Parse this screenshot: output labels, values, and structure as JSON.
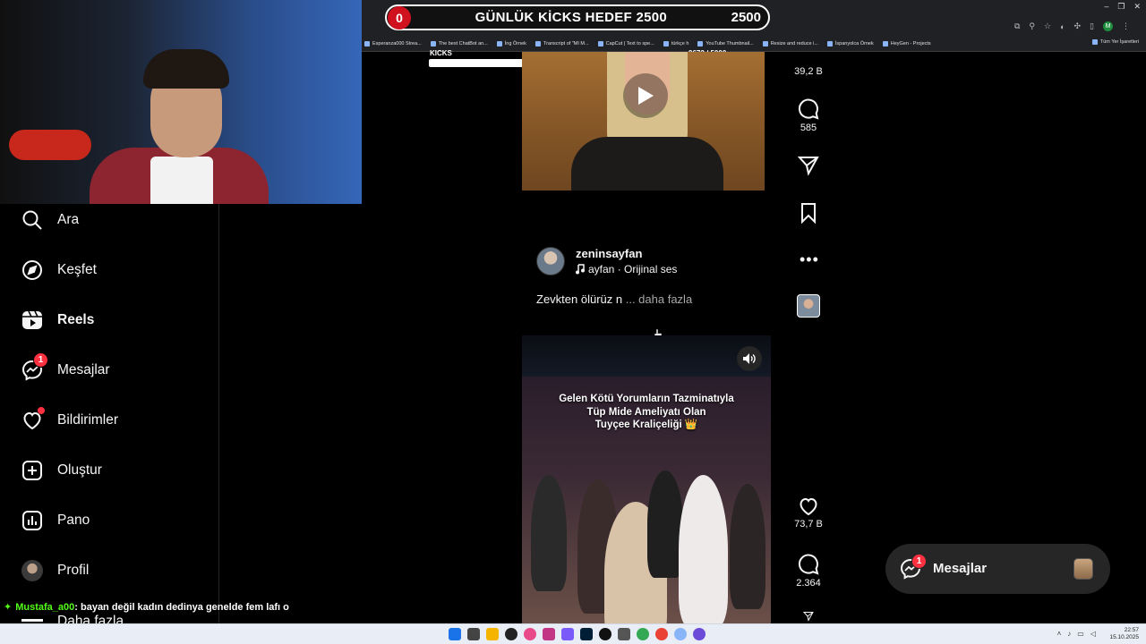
{
  "stream_overlay": {
    "goal_title": "GÜNLÜK KİCKS HEDEF 2500",
    "current_count": "0",
    "target": "2500",
    "kicks_label": "KICKS",
    "kicks_progress_text": "9672 / 5000",
    "kicks_progress_fraction": 1.0
  },
  "browser": {
    "bookmarks": [
      {
        "label": "Esperanza000 Strea...",
        "icon": "kick-icon"
      },
      {
        "label": "The best ChatBot an...",
        "icon": "bot-icon"
      },
      {
        "label": "İng Örnek",
        "icon": "folder-icon"
      },
      {
        "label": "Transcript of \"MI M...",
        "icon": "page-icon"
      },
      {
        "label": "CapCut | Text to spe...",
        "icon": "capcut-icon"
      },
      {
        "label": "türkçe h",
        "icon": "folder-icon"
      },
      {
        "label": "YouTube Thumbnail...",
        "icon": "youtube-icon"
      },
      {
        "label": "Resize and reduce i...",
        "icon": "page-icon"
      },
      {
        "label": "İspanyolca Örnek",
        "icon": "folder-icon"
      },
      {
        "label": "HeyGen - Projects",
        "icon": "heygen-icon"
      }
    ],
    "all_bookmarks_label": "Tüm Yer İşaretleri",
    "profile_initial": "M"
  },
  "sidebar": {
    "items": [
      {
        "label": "Ara",
        "icon": "search-icon",
        "top": 0
      },
      {
        "label": "Keşfet",
        "icon": "compass-icon"
      },
      {
        "label": "Reels",
        "icon": "reels-icon",
        "active": true
      },
      {
        "label": "Mesajlar",
        "icon": "messenger-icon",
        "badge": "1"
      },
      {
        "label": "Bildirimler",
        "icon": "heart-icon",
        "dot": true
      },
      {
        "label": "Oluştur",
        "icon": "create-icon"
      },
      {
        "label": "Pano",
        "icon": "dashboard-icon"
      },
      {
        "label": "Profil",
        "icon": "profile-avatar-icon"
      }
    ],
    "more_label": "Daha fazla"
  },
  "reel_top": {
    "likes": "39,2 B",
    "comments": "585"
  },
  "post": {
    "author": "zeninsayfan",
    "audio": "ayfan · Orijinal ses",
    "caption": "Zevkten ölürüz n",
    "caption_more": "... daha fazla"
  },
  "reel_main": {
    "overlay_text_lines": [
      "Gelen Kötü Yorumların Tazminatıyla",
      "Tüp Mide Ameliyatı Olan",
      "Tuyçee Kraliçeliği 👑"
    ],
    "likes": "73,7 B",
    "comments": "2.364"
  },
  "messages_pill": {
    "label": "Mesajlar",
    "badge": "1"
  },
  "chat": {
    "username": "Mustafa_a00",
    "message": ": bayan değil kadın dedinya genelde fem lafı o"
  },
  "taskbar": {
    "time": "22:57",
    "date": "15.10.2025"
  },
  "colors": {
    "background": "#000000",
    "accent_red": "#ff3040",
    "kick_green": "#53fc18",
    "goal_red": "#d0121f"
  }
}
